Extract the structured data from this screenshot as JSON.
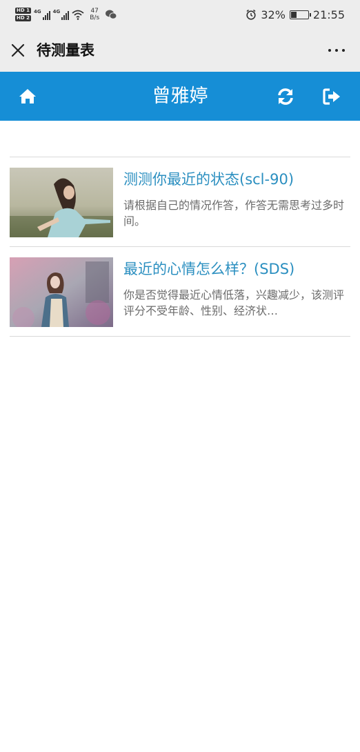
{
  "status_bar": {
    "hd1": "HD 1",
    "hd2": "HD 2",
    "sig1": "4G",
    "sig2": "4G",
    "net_speed_value": "47",
    "net_speed_unit": "B/s",
    "battery": "32%",
    "battery_level": 0.32,
    "time": "21:55"
  },
  "title_bar": {
    "title": "待测量表"
  },
  "header": {
    "user_name": "曾雅婷",
    "icons": [
      "home-icon",
      "refresh-icon",
      "logout-icon"
    ],
    "background_color": "#168ed6"
  },
  "items": [
    {
      "title": "测测你最近的状态(scl-90)",
      "description": "请根据自己的情况作答，作答无需思考过多时间。"
    },
    {
      "title": "最近的心情怎么样？(SDS)",
      "description": "你是否觉得最近心情低落，兴趣减少，该测评评分不受年龄、性别、经济状…"
    }
  ],
  "colors": {
    "title_text": "#2b8fc0",
    "desc_text": "#6b6b6b",
    "divider": "#d9d9d9"
  }
}
